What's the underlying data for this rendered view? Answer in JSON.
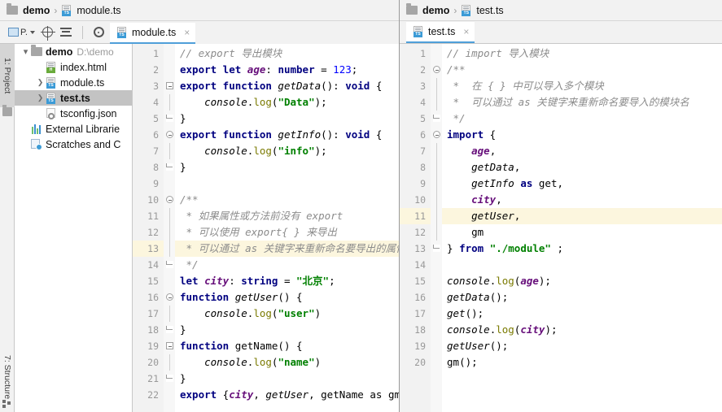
{
  "left_window": {
    "breadcrumb": {
      "project": "demo",
      "separator": "›",
      "file": "module.ts"
    },
    "toolbar": {
      "project_label": "P.",
      "buttons": [
        {
          "name": "project-view-selector",
          "label": "P."
        },
        {
          "name": "scroll-from-source-icon",
          "label": ""
        },
        {
          "name": "collapse-all-icon",
          "label": ""
        },
        {
          "name": "settings-gear-icon",
          "label": ""
        }
      ]
    },
    "tabs": [
      {
        "label": "module.ts",
        "close": "×",
        "active": true
      }
    ],
    "sidebar_vertical_tabs": [
      {
        "label": "1: Project",
        "selected": true
      },
      {
        "label": "7: Structure",
        "selected": false
      }
    ],
    "tree": [
      {
        "indent": 0,
        "arrow": "down",
        "icon": "folder-icon",
        "label": "demo",
        "bold": true,
        "sub": "D:\\demo",
        "selected": false
      },
      {
        "indent": 1,
        "arrow": "none",
        "icon": "html-file-icon",
        "label": "index.html",
        "bold": false,
        "sub": "",
        "selected": false
      },
      {
        "indent": 1,
        "arrow": "right",
        "icon": "ts-file-icon",
        "label": "module.ts",
        "bold": false,
        "sub": "",
        "selected": false
      },
      {
        "indent": 1,
        "arrow": "right",
        "icon": "ts-file-icon",
        "label": "test.ts",
        "bold": true,
        "sub": "",
        "selected": true
      },
      {
        "indent": 1,
        "arrow": "none",
        "icon": "json-file-icon",
        "label": "tsconfig.json",
        "bold": false,
        "sub": "",
        "selected": false
      },
      {
        "indent": 0,
        "arrow": "none",
        "icon": "library-icon",
        "label": "External Librarie",
        "bold": false,
        "sub": "",
        "selected": false
      },
      {
        "indent": 0,
        "arrow": "none",
        "icon": "scratches-icon",
        "label": "Scratches and C",
        "bold": false,
        "sub": "",
        "selected": false
      }
    ],
    "editor": {
      "filename": "module.ts",
      "highlighted_line": 13,
      "lines": [
        {
          "n": 1,
          "fold": "none",
          "tokens": [
            {
              "t": "// export 导出模块",
              "c": "c-com"
            }
          ]
        },
        {
          "n": 2,
          "fold": "none",
          "tokens": [
            {
              "t": "export let ",
              "c": "c-kw"
            },
            {
              "t": "age",
              "c": "c-var"
            },
            {
              "t": ": ",
              "c": "c-pl"
            },
            {
              "t": "number",
              "c": "c-kw"
            },
            {
              "t": " = ",
              "c": "c-pl"
            },
            {
              "t": "123",
              "c": "c-num"
            },
            {
              "t": ";",
              "c": "c-pl"
            }
          ]
        },
        {
          "n": 3,
          "fold": "start",
          "tokens": [
            {
              "t": "export function ",
              "c": "c-kw"
            },
            {
              "t": "getData",
              "c": "c-id"
            },
            {
              "t": "(): ",
              "c": "c-pl"
            },
            {
              "t": "void",
              "c": "c-kw"
            },
            {
              "t": " {",
              "c": "c-pl"
            }
          ]
        },
        {
          "n": 4,
          "fold": "bar",
          "tokens": [
            {
              "t": "    ",
              "c": "c-pl"
            },
            {
              "t": "console",
              "c": "c-id"
            },
            {
              "t": ".",
              "c": "c-pl"
            },
            {
              "t": "log",
              "c": "c-meth"
            },
            {
              "t": "(",
              "c": "c-pl"
            },
            {
              "t": "\"Data\"",
              "c": "c-str"
            },
            {
              "t": ");",
              "c": "c-pl"
            }
          ]
        },
        {
          "n": 5,
          "fold": "end",
          "tokens": [
            {
              "t": "}",
              "c": "c-pl"
            }
          ]
        },
        {
          "n": 6,
          "fold": "start-round",
          "tokens": [
            {
              "t": "export function ",
              "c": "c-kw"
            },
            {
              "t": "getInfo",
              "c": "c-id"
            },
            {
              "t": "(): ",
              "c": "c-pl"
            },
            {
              "t": "void",
              "c": "c-kw"
            },
            {
              "t": " {",
              "c": "c-pl"
            }
          ]
        },
        {
          "n": 7,
          "fold": "bar",
          "tokens": [
            {
              "t": "    ",
              "c": "c-pl"
            },
            {
              "t": "console",
              "c": "c-id"
            },
            {
              "t": ".",
              "c": "c-pl"
            },
            {
              "t": "log",
              "c": "c-meth"
            },
            {
              "t": "(",
              "c": "c-pl"
            },
            {
              "t": "\"info\"",
              "c": "c-str"
            },
            {
              "t": ");",
              "c": "c-pl"
            }
          ]
        },
        {
          "n": 8,
          "fold": "end",
          "tokens": [
            {
              "t": "}",
              "c": "c-pl"
            }
          ]
        },
        {
          "n": 9,
          "fold": "none",
          "tokens": []
        },
        {
          "n": 10,
          "fold": "start-round",
          "tokens": [
            {
              "t": "/**",
              "c": "c-com"
            }
          ]
        },
        {
          "n": 11,
          "fold": "bar",
          "tokens": [
            {
              "t": " * 如果属性或方法前没有 export",
              "c": "c-com"
            }
          ]
        },
        {
          "n": 12,
          "fold": "bar",
          "tokens": [
            {
              "t": " * 可以使用 export{ } 来导出",
              "c": "c-com"
            }
          ]
        },
        {
          "n": 13,
          "fold": "bar",
          "tokens": [
            {
              "t": " * 可以通过 as 关键字来重新命名要导出的属性",
              "c": "c-com"
            }
          ]
        },
        {
          "n": 14,
          "fold": "end",
          "tokens": [
            {
              "t": " */",
              "c": "c-com"
            }
          ]
        },
        {
          "n": 15,
          "fold": "none",
          "tokens": [
            {
              "t": "let ",
              "c": "c-kw"
            },
            {
              "t": "city",
              "c": "c-var"
            },
            {
              "t": ": ",
              "c": "c-pl"
            },
            {
              "t": "string",
              "c": "c-kw"
            },
            {
              "t": " = ",
              "c": "c-pl"
            },
            {
              "t": "\"北京\"",
              "c": "c-str"
            },
            {
              "t": ";",
              "c": "c-pl"
            }
          ]
        },
        {
          "n": 16,
          "fold": "start-round",
          "tokens": [
            {
              "t": "function ",
              "c": "c-kw"
            },
            {
              "t": "getUser",
              "c": "c-id"
            },
            {
              "t": "() {",
              "c": "c-pl"
            }
          ]
        },
        {
          "n": 17,
          "fold": "bar",
          "tokens": [
            {
              "t": "    ",
              "c": "c-pl"
            },
            {
              "t": "console",
              "c": "c-id"
            },
            {
              "t": ".",
              "c": "c-pl"
            },
            {
              "t": "log",
              "c": "c-meth"
            },
            {
              "t": "(",
              "c": "c-pl"
            },
            {
              "t": "\"user\"",
              "c": "c-str"
            },
            {
              "t": ")",
              "c": "c-pl"
            }
          ]
        },
        {
          "n": 18,
          "fold": "end",
          "tokens": [
            {
              "t": "}",
              "c": "c-pl"
            }
          ]
        },
        {
          "n": 19,
          "fold": "start",
          "tokens": [
            {
              "t": "function ",
              "c": "c-kw"
            },
            {
              "t": "getName",
              "c": "c-pl"
            },
            {
              "t": "() {",
              "c": "c-pl"
            }
          ]
        },
        {
          "n": 20,
          "fold": "bar",
          "tokens": [
            {
              "t": "    ",
              "c": "c-pl"
            },
            {
              "t": "console",
              "c": "c-id"
            },
            {
              "t": ".",
              "c": "c-pl"
            },
            {
              "t": "log",
              "c": "c-meth"
            },
            {
              "t": "(",
              "c": "c-pl"
            },
            {
              "t": "\"name\"",
              "c": "c-str"
            },
            {
              "t": ")",
              "c": "c-pl"
            }
          ]
        },
        {
          "n": 21,
          "fold": "end",
          "tokens": [
            {
              "t": "}",
              "c": "c-pl"
            }
          ]
        },
        {
          "n": 22,
          "fold": "none",
          "tokens": [
            {
              "t": "export",
              "c": "c-kw"
            },
            {
              "t": " {",
              "c": "c-pl"
            },
            {
              "t": "city",
              "c": "c-var"
            },
            {
              "t": ", ",
              "c": "c-pl"
            },
            {
              "t": "getUser",
              "c": "c-id"
            },
            {
              "t": ", ",
              "c": "c-pl"
            },
            {
              "t": "getName",
              "c": "c-pl"
            },
            {
              "t": " as ",
              "c": "c-pl"
            },
            {
              "t": "gm",
              "c": "c-pl"
            },
            {
              "t": "};",
              "c": "c-pl"
            }
          ]
        }
      ]
    }
  },
  "right_window": {
    "breadcrumb": {
      "project": "demo",
      "separator": "›",
      "file": "test.ts"
    },
    "tabs": [
      {
        "label": "test.ts",
        "close": "×",
        "active": true
      }
    ],
    "editor": {
      "filename": "test.ts",
      "highlighted_line": 11,
      "lines": [
        {
          "n": 1,
          "fold": "none",
          "tokens": [
            {
              "t": "// import 导入模块",
              "c": "c-com"
            }
          ]
        },
        {
          "n": 2,
          "fold": "start-round",
          "tokens": [
            {
              "t": "/**",
              "c": "c-com"
            }
          ]
        },
        {
          "n": 3,
          "fold": "bar",
          "tokens": [
            {
              "t": " *  在 { } 中可以导入多个模块",
              "c": "c-com"
            }
          ]
        },
        {
          "n": 4,
          "fold": "bar",
          "tokens": [
            {
              "t": " *  可以通过 as 关键字来重新命名要导入的模块名",
              "c": "c-com"
            }
          ]
        },
        {
          "n": 5,
          "fold": "end",
          "tokens": [
            {
              "t": " */",
              "c": "c-com"
            }
          ]
        },
        {
          "n": 6,
          "fold": "start-round",
          "tokens": [
            {
              "t": "import",
              "c": "c-kw"
            },
            {
              "t": " {",
              "c": "c-pl"
            }
          ]
        },
        {
          "n": 7,
          "fold": "bar",
          "tokens": [
            {
              "t": "    ",
              "c": "c-pl"
            },
            {
              "t": "age",
              "c": "c-var"
            },
            {
              "t": ",",
              "c": "c-pl"
            }
          ]
        },
        {
          "n": 8,
          "fold": "bar",
          "tokens": [
            {
              "t": "    ",
              "c": "c-pl"
            },
            {
              "t": "getData",
              "c": "c-id"
            },
            {
              "t": ",",
              "c": "c-pl"
            }
          ]
        },
        {
          "n": 9,
          "fold": "bar",
          "tokens": [
            {
              "t": "    ",
              "c": "c-pl"
            },
            {
              "t": "getInfo",
              "c": "c-id"
            },
            {
              "t": " as ",
              "c": "c-kw"
            },
            {
              "t": "get",
              "c": "c-pl"
            },
            {
              "t": ",",
              "c": "c-pl"
            }
          ]
        },
        {
          "n": 10,
          "fold": "bar",
          "tokens": [
            {
              "t": "    ",
              "c": "c-pl"
            },
            {
              "t": "city",
              "c": "c-var"
            },
            {
              "t": ",",
              "c": "c-pl"
            }
          ]
        },
        {
          "n": 11,
          "fold": "bar",
          "tokens": [
            {
              "t": "    ",
              "c": "c-pl"
            },
            {
              "t": "getUser",
              "c": "c-id"
            },
            {
              "t": ",",
              "c": "c-pl"
            }
          ]
        },
        {
          "n": 12,
          "fold": "bar",
          "tokens": [
            {
              "t": "    ",
              "c": "c-pl"
            },
            {
              "t": "gm",
              "c": "c-pl"
            }
          ]
        },
        {
          "n": 13,
          "fold": "end",
          "tokens": [
            {
              "t": "} ",
              "c": "c-pl"
            },
            {
              "t": "from",
              "c": "c-kw"
            },
            {
              "t": " ",
              "c": "c-pl"
            },
            {
              "t": "\"./module\"",
              "c": "c-str"
            },
            {
              "t": " ;",
              "c": "c-pl"
            }
          ]
        },
        {
          "n": 14,
          "fold": "none",
          "tokens": []
        },
        {
          "n": 15,
          "fold": "none",
          "tokens": [
            {
              "t": "console",
              "c": "c-id"
            },
            {
              "t": ".",
              "c": "c-pl"
            },
            {
              "t": "log",
              "c": "c-meth"
            },
            {
              "t": "(",
              "c": "c-pl"
            },
            {
              "t": "age",
              "c": "c-var"
            },
            {
              "t": ");",
              "c": "c-pl"
            }
          ]
        },
        {
          "n": 16,
          "fold": "none",
          "tokens": [
            {
              "t": "getData",
              "c": "c-id"
            },
            {
              "t": "();",
              "c": "c-pl"
            }
          ]
        },
        {
          "n": 17,
          "fold": "none",
          "tokens": [
            {
              "t": "get",
              "c": "c-id"
            },
            {
              "t": "();",
              "c": "c-pl"
            }
          ]
        },
        {
          "n": 18,
          "fold": "none",
          "tokens": [
            {
              "t": "console",
              "c": "c-id"
            },
            {
              "t": ".",
              "c": "c-pl"
            },
            {
              "t": "log",
              "c": "c-meth"
            },
            {
              "t": "(",
              "c": "c-pl"
            },
            {
              "t": "city",
              "c": "c-var"
            },
            {
              "t": ");",
              "c": "c-pl"
            }
          ]
        },
        {
          "n": 19,
          "fold": "none",
          "tokens": [
            {
              "t": "getUser",
              "c": "c-id"
            },
            {
              "t": "();",
              "c": "c-pl"
            }
          ]
        },
        {
          "n": 20,
          "fold": "none",
          "tokens": [
            {
              "t": "gm",
              "c": "c-pl"
            },
            {
              "t": "();",
              "c": "c-pl"
            }
          ]
        }
      ]
    }
  },
  "colors": {
    "accent": "#4f9fd9",
    "highlight_line": "#fcf6de",
    "selection": "#c3c3c3",
    "keyword": "#000080",
    "string": "#008000",
    "number": "#0000ff",
    "comment": "#8c8c8c",
    "variable": "#660e7a"
  }
}
